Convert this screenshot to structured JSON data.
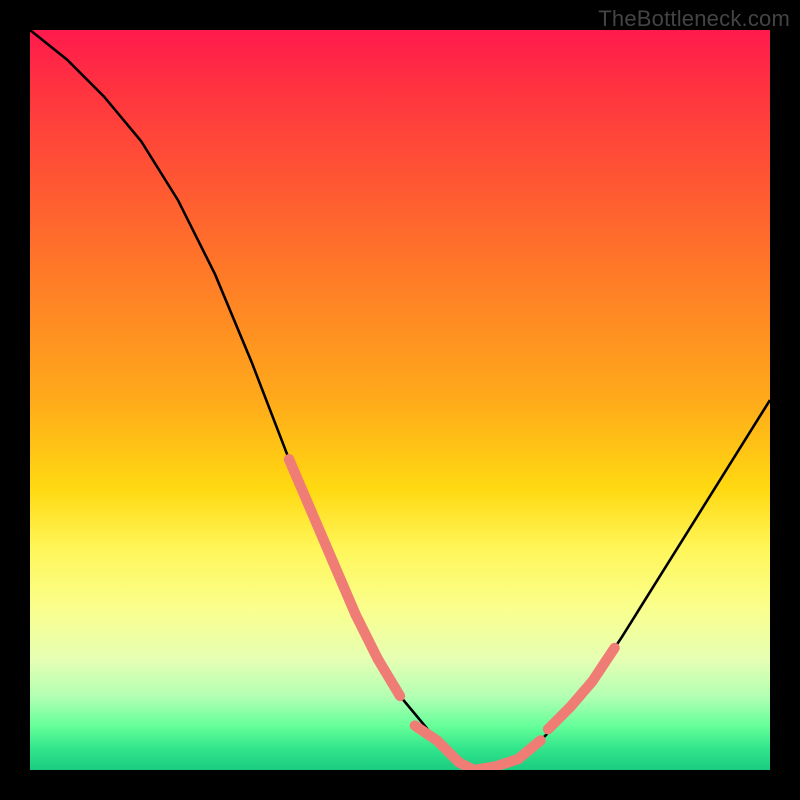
{
  "watermark": "TheBottleneck.com",
  "chart_data": {
    "type": "line",
    "title": "",
    "xlabel": "",
    "ylabel": "",
    "xlim": [
      0,
      100
    ],
    "ylim": [
      0,
      100
    ],
    "grid": false,
    "legend": false,
    "series": [
      {
        "name": "bottleneck-curve",
        "color": "#000000",
        "x": [
          0,
          5,
          10,
          15,
          20,
          25,
          30,
          35,
          40,
          45,
          50,
          55,
          58,
          60,
          62,
          65,
          68,
          72,
          76,
          80,
          85,
          90,
          95,
          100
        ],
        "values": [
          100,
          96,
          91,
          85,
          77,
          67,
          55,
          42,
          30,
          19,
          10,
          4,
          1,
          0,
          0,
          1,
          3,
          7,
          12,
          18,
          26,
          34,
          42,
          50
        ]
      },
      {
        "name": "highlight-segments",
        "color": "#ef7d76",
        "segments": [
          {
            "x": [
              35,
              38,
              41,
              44,
              47,
              50
            ],
            "values": [
              42,
              35,
              28,
              21,
              15,
              10
            ]
          },
          {
            "x": [
              52,
              55,
              58,
              60,
              63,
              66,
              69
            ],
            "values": [
              6,
              4,
              1,
              0,
              0.5,
              1.5,
              4
            ]
          },
          {
            "x": [
              70,
              73,
              76,
              79
            ],
            "values": [
              5.5,
              8.5,
              12,
              16.5
            ]
          }
        ]
      }
    ],
    "background": {
      "type": "vertical-gradient",
      "stops": [
        {
          "pos": 0,
          "color": "#ff1a4d"
        },
        {
          "pos": 50,
          "color": "#ffaa1a"
        },
        {
          "pos": 75,
          "color": "#faff8c"
        },
        {
          "pos": 100,
          "color": "#1acc80"
        }
      ]
    }
  }
}
